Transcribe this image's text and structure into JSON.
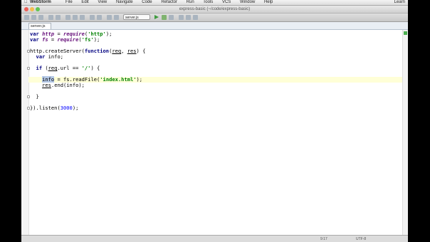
{
  "menubar": {
    "app_name": "WebStorm",
    "menus": [
      "File",
      "Edit",
      "View",
      "Navigate",
      "Code",
      "Refactor",
      "Run",
      "Tools",
      "VCS",
      "Window",
      "Help"
    ],
    "user": "Learn"
  },
  "window": {
    "title": "express-basic (~/code/express-basic)"
  },
  "toolbar": {
    "run_config": "server.js"
  },
  "tabs": [
    {
      "label": "server.js"
    }
  ],
  "editor": {
    "lines": [
      {
        "code": "var http = require('http');"
      },
      {
        "code": "var fs = require('fs');"
      },
      {
        "code": ""
      },
      {
        "code": "http.createServer(function(req, res) {"
      },
      {
        "code": "  var info;"
      },
      {
        "code": ""
      },
      {
        "code": "  if (req.url == '/') {"
      },
      {
        "code": ""
      },
      {
        "code": "    info = fs.readFile('index.html');"
      },
      {
        "code": "    res.end(info);"
      },
      {
        "code": ""
      },
      {
        "code": "  }"
      },
      {
        "code": ""
      },
      {
        "code": "}).listen(3000);"
      }
    ]
  },
  "statusbar": {
    "position": "9:17",
    "encoding": "UTF-8"
  },
  "colors": {
    "keyword": "#000080",
    "string": "#008000",
    "number": "#0000ff",
    "selection": "#b4c8e6",
    "current_line": "#ffffd7"
  }
}
